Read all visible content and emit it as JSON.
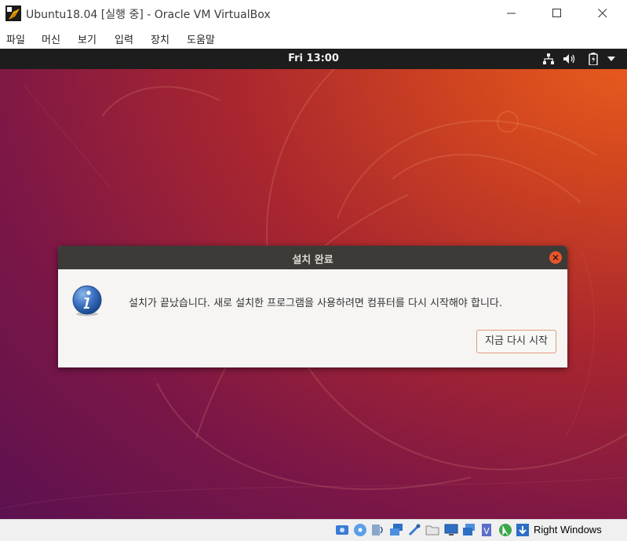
{
  "window": {
    "title": "Ubuntu18.04 [실행 중] - Oracle VM VirtualBox",
    "controls": [
      "minimize-icon",
      "maximize-icon",
      "close-icon"
    ]
  },
  "menubar": {
    "items": [
      "파일",
      "머신",
      "보기",
      "입력",
      "장치",
      "도움말"
    ]
  },
  "guest": {
    "topbar": {
      "clock": "Fri 13:00",
      "tray_icons": [
        "network-icon",
        "volume-icon",
        "battery-icon",
        "dropdown-arrow-icon"
      ]
    },
    "dialog": {
      "title": "설치 완료",
      "message": "설치가 끝났습니다. 새로 설치한 프로그램을 사용하려면 컴퓨터를 다시 시작해야 합니다.",
      "button_label": "지금 다시 시작",
      "icon": "info-icon"
    }
  },
  "statusbar": {
    "icons": [
      "hard-disk-icon",
      "optical-drive-icon",
      "audio-icon",
      "network-icon",
      "usb-icon",
      "shared-folders-icon",
      "display-icon",
      "video-capture-icon",
      "virtualization-icon",
      "mouse-integration-icon",
      "keyboard-icon"
    ],
    "host_key": "Right Windows"
  },
  "colors": {
    "ubuntu_orange": "#e95420",
    "aubergine": "#5c1150",
    "topbar": "#1d1d1d",
    "dialog_header": "#3c3b37"
  }
}
